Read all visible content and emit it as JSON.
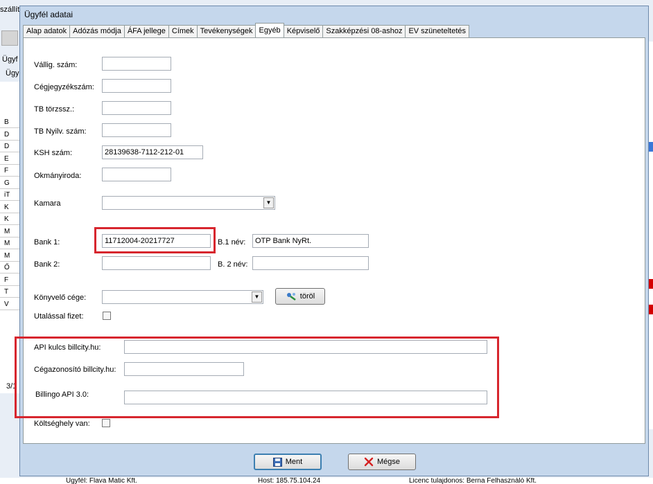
{
  "background": {
    "title_fragment": "szállít",
    "side_label_1": "Ügyf",
    "side_label_2": "Ügy",
    "rows": [
      "B",
      "D",
      "D",
      "E",
      "F",
      "G",
      "iT",
      "K",
      "K",
      "M",
      "M",
      "M",
      "Ő",
      "F",
      "T",
      "V"
    ],
    "status": "3/1",
    "bottom_texts": [
      "Ügyfél: Flava Matic Kft.",
      "Host: 185.75.104.24",
      "Licenc tulajdonos: Berna Felhasználó Kft."
    ]
  },
  "dialog": {
    "title": "Ügyfél adatai",
    "tabs": [
      "Alap adatok",
      "Adózás módja",
      "ÁFA jellege",
      "Címek",
      "Tevékenységek",
      "Egyéb",
      "Képviselő",
      "Szakképzési 08-ashoz",
      "EV szüneteltetés"
    ],
    "active_tab": "Egyéb",
    "fields": {
      "vallig_szam": {
        "label": "Vállig. szám:",
        "value": ""
      },
      "cegjegyzekszam": {
        "label": "Cégjegyzékszám:",
        "value": ""
      },
      "tb_torzssz": {
        "label": "TB törzssz.:",
        "value": ""
      },
      "tb_nyilv_szam": {
        "label": "TB Nyilv. szám:",
        "value": ""
      },
      "ksh_szam": {
        "label": "KSH szám:",
        "value": "28139638-7112-212-01"
      },
      "okmanyiroda": {
        "label": "Okmányiroda:",
        "value": ""
      },
      "kamara": {
        "label": "Kamara",
        "value": ""
      },
      "bank1": {
        "label": "Bank 1:",
        "value": "11712004-20217727"
      },
      "b1_nev": {
        "label": "B.1 név:",
        "value": "OTP Bank NyRt."
      },
      "bank2": {
        "label": "Bank 2:",
        "value": ""
      },
      "b2_nev": {
        "label": "B. 2 név:",
        "value": ""
      },
      "konyvelo_cege": {
        "label": "Könyvelő cége:",
        "value": ""
      },
      "utalassal_fizet": {
        "label": "Utalással fizet:",
        "checked": false
      },
      "api_kulcs": {
        "label": "API kulcs billcity.hu:",
        "value": ""
      },
      "cegazonosito": {
        "label": "Cégazonosító billcity.hu:",
        "value": ""
      },
      "billingo": {
        "label": "Billingo API 3.0:",
        "value": ""
      },
      "koltseghely": {
        "label": "Költséghely van:",
        "checked": false
      }
    },
    "torol_label": "töröl",
    "ment_label": "Ment",
    "megse_label": "Mégse"
  },
  "colors": {
    "highlight_red": "#d7262e",
    "dialog_bg": "#c5d7ec"
  }
}
